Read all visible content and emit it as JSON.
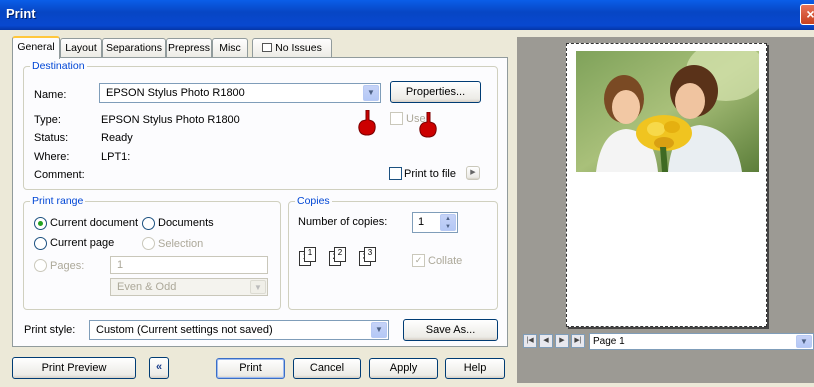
{
  "window": {
    "title": "Print",
    "close_icon": "×"
  },
  "tabs": [
    "General",
    "Layout",
    "Separations",
    "Prepress",
    "Misc",
    "No Issues"
  ],
  "destination": {
    "legend": "Destination",
    "name_label": "Name:",
    "name_value": "EPSON Stylus Photo R1800",
    "properties_button": "Properties...",
    "type_label": "Type:",
    "type_value": "EPSON Stylus Photo R1800",
    "status_label": "Status:",
    "status_value": "Ready",
    "where_label": "Where:",
    "where_value": "LPT1:",
    "comment_label": "Comment:",
    "use_label": "Use",
    "print_to_file_label": "Print to file"
  },
  "print_range": {
    "legend": "Print range",
    "current_document": "Current document",
    "documents": "Documents",
    "current_page": "Current page",
    "selection": "Selection",
    "pages_label": "Pages:",
    "pages_value": "1",
    "subset_value": "Even & Odd"
  },
  "copies": {
    "legend": "Copies",
    "number_label": "Number of copies:",
    "number_value": "1",
    "collate_label": "Collate",
    "collate_digits": [
      "1",
      "1",
      "2",
      "2",
      "3",
      "3"
    ]
  },
  "print_style": {
    "label": "Print style:",
    "value": "Custom (Current settings not saved)",
    "save_as": "Save As..."
  },
  "preview": {
    "page_label": "Page 1"
  },
  "buttons": {
    "print_preview": "Print Preview",
    "collapse_icon": "«",
    "print": "Print",
    "cancel": "Cancel",
    "apply": "Apply",
    "help": "Help"
  },
  "colors": {
    "title_bar": "#0a5ee8",
    "accent_tab": "#ffc73c",
    "legend": "#0046d5",
    "cursor": "#cc0000"
  }
}
